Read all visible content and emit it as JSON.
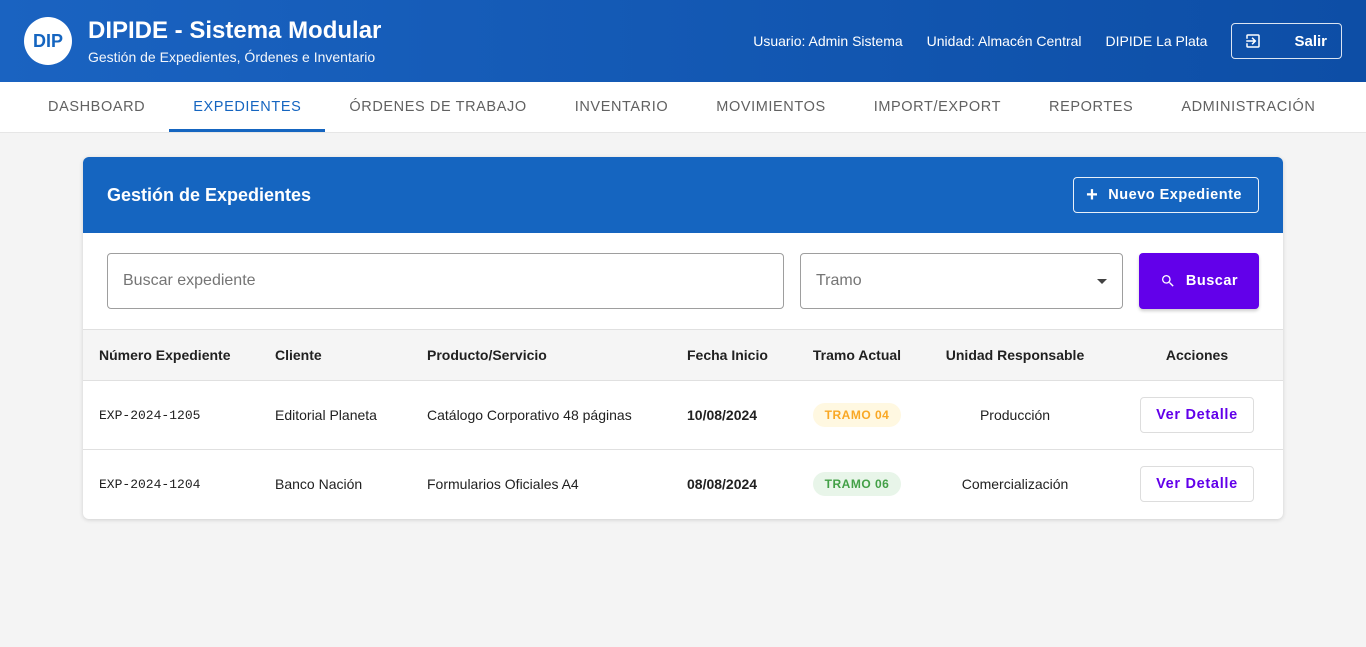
{
  "app": {
    "logo": "DIP",
    "title": "DIPIDE - Sistema Modular",
    "subtitle": "Gestión de Expedientes, Órdenes e Inventario",
    "user": "Usuario: Admin Sistema",
    "unit": "Unidad: Almacén Central",
    "org": "DIPIDE La Plata",
    "logout_label": "Salir",
    "logout_icon": "logout-icon"
  },
  "tabs": [
    {
      "label": "DASHBOARD",
      "active": false
    },
    {
      "label": "EXPEDIENTES",
      "active": true
    },
    {
      "label": "ÓRDENES DE TRABAJO",
      "active": false
    },
    {
      "label": "INVENTARIO",
      "active": false
    },
    {
      "label": "MOVIMIENTOS",
      "active": false
    },
    {
      "label": "IMPORT/EXPORT",
      "active": false
    },
    {
      "label": "REPORTES",
      "active": false
    },
    {
      "label": "ADMINISTRACIÓN",
      "active": false
    }
  ],
  "panel": {
    "title": "Gestión de Expedientes",
    "new_button": "Nuevo Expediente"
  },
  "filters": {
    "search_placeholder": "Buscar expediente",
    "search_value": "",
    "tramo_placeholder": "Tramo",
    "search_button": "Buscar"
  },
  "table": {
    "columns": [
      "Número Expediente",
      "Cliente",
      "Producto/Servicio",
      "Fecha Inicio",
      "Tramo Actual",
      "Unidad Responsable",
      "Acciones"
    ],
    "rows": [
      {
        "numero": "EXP-2024-1205",
        "cliente": "Editorial Planeta",
        "producto": "Catálogo Corporativo 48 páginas",
        "fecha": "10/08/2024",
        "tramo": "TRAMO 04",
        "unidad": "Producción",
        "accion": "Ver Detalle"
      },
      {
        "numero": "EXP-2024-1204",
        "cliente": "Banco Nación",
        "producto": "Formularios Oficiales A4",
        "fecha": "08/08/2024",
        "tramo": "TRAMO 06",
        "unidad": "Comercialización",
        "accion": "Ver Detalle"
      }
    ]
  },
  "colors": {
    "primary": "#1565c0",
    "accent": "#6200ea",
    "tramo04_bg": "#fff8e1",
    "tramo04_fg": "#f9a825",
    "tramo06_bg": "#e8f5e9",
    "tramo06_fg": "#43a047"
  }
}
